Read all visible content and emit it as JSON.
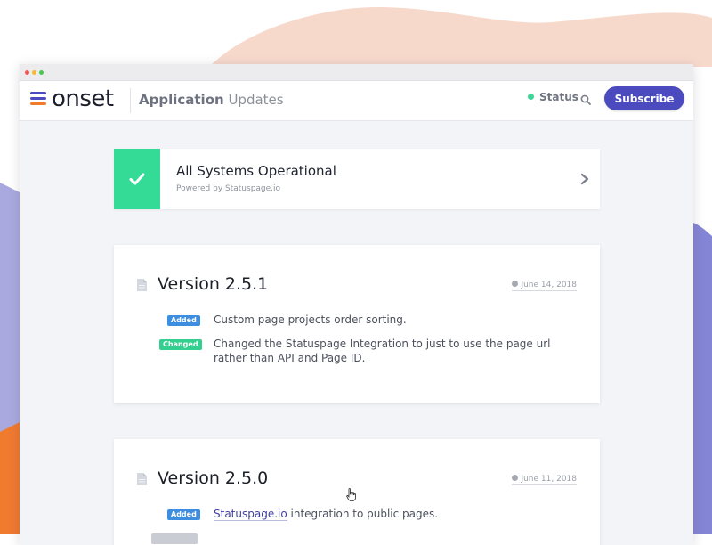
{
  "app": {
    "brand": "onset",
    "title_bold": "Application",
    "title_light": " Updates"
  },
  "nav": {
    "status_label": "Status",
    "search_icon": "search-icon",
    "subscribe_label": "Subscribe"
  },
  "status": {
    "title": "All Systems Operational",
    "subtitle": "Powered by Statuspage.io",
    "color": "#33db97"
  },
  "releases": [
    {
      "version": "Version 2.5.1",
      "date": "June 14, 2018",
      "entries": [
        {
          "badge": "Added",
          "text": "Custom page projects order sorting."
        },
        {
          "badge": "Changed",
          "text": "Changed the Statuspage Integration to just to use the page url rather than API and Page ID."
        }
      ]
    },
    {
      "version": "Version 2.5.0",
      "date": "June 11, 2018",
      "entries": [
        {
          "badge": "Added",
          "link": "Statuspage.io",
          "text": " integration to public pages."
        }
      ]
    }
  ],
  "colors": {
    "accent": "#4b4bbf",
    "added": "#3d8de0",
    "changed": "#33cf8e",
    "page_bg": "#f2f4f8"
  }
}
